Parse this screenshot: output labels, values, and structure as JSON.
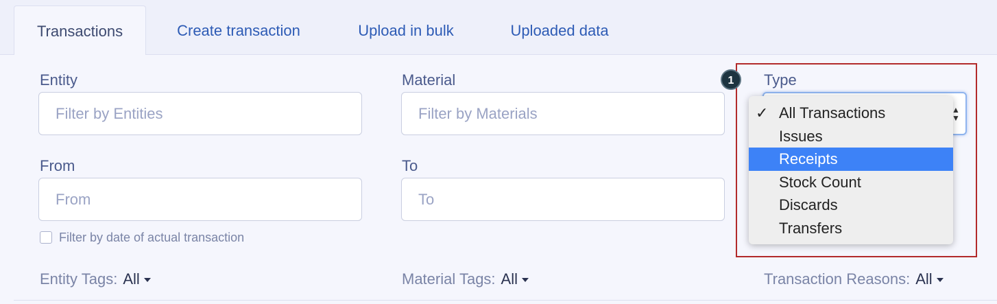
{
  "tabs": [
    {
      "label": "Transactions",
      "active": true
    },
    {
      "label": "Create transaction",
      "active": false
    },
    {
      "label": "Upload in bulk",
      "active": false
    },
    {
      "label": "Uploaded data",
      "active": false
    }
  ],
  "filters": {
    "entity": {
      "label": "Entity",
      "placeholder": "Filter by Entities"
    },
    "material": {
      "label": "Material",
      "placeholder": "Filter by Materials"
    },
    "type": {
      "label": "Type"
    },
    "from": {
      "label": "From",
      "placeholder": "From"
    },
    "to": {
      "label": "To",
      "placeholder": "To"
    },
    "actual_date_checkbox": {
      "label": "Filter by date of actual transaction",
      "checked": false
    }
  },
  "type_menu": {
    "check_glyph": "✓",
    "selected": "All Transactions",
    "highlighted": "Receipts",
    "options": [
      "All Transactions",
      "Issues",
      "Receipts",
      "Stock Count",
      "Discards",
      "Transfers"
    ]
  },
  "tag_filters": {
    "entity_tags": {
      "label": "Entity Tags:",
      "value": "All"
    },
    "material_tags": {
      "label": "Material Tags:",
      "value": "All"
    },
    "transaction_reasons": {
      "label": "Transaction Reasons:",
      "value": "All"
    }
  },
  "annotation": {
    "badge": "1",
    "highlight_color": "#b22a2a"
  },
  "colors": {
    "accent": "#2d5bb5",
    "menu_highlight": "#3d82f7",
    "background": "#f5f6fd"
  }
}
